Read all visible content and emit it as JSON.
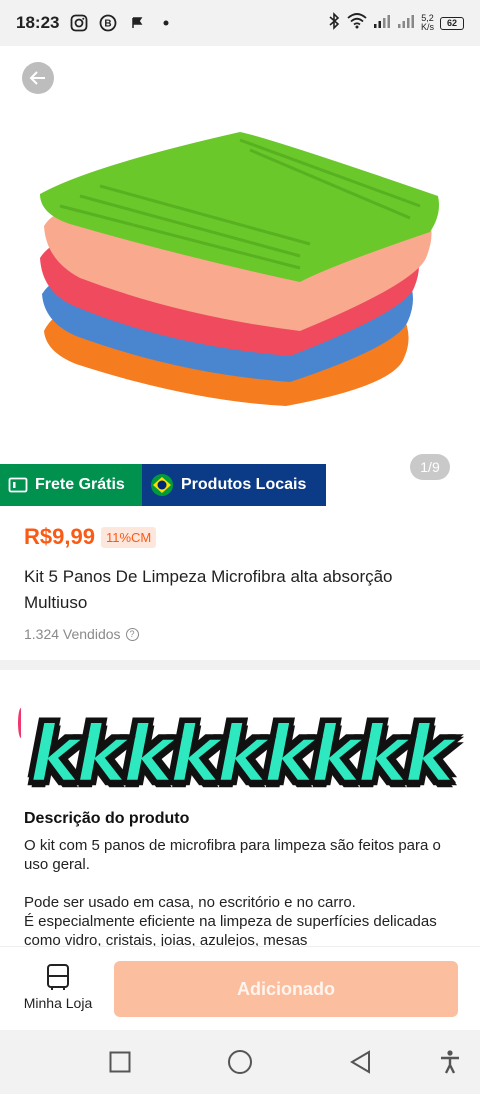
{
  "status_bar": {
    "time": "18:23",
    "net_speed_value": "5,2",
    "net_speed_unit": "K/s",
    "battery": "62"
  },
  "gallery": {
    "counter": "1/9"
  },
  "badges": {
    "free_shipping": "Frete Grátis",
    "local_products": "Produtos Locais"
  },
  "product": {
    "price": "R$9,99",
    "discount": "11%CM",
    "title": "Kit 5 Panos De Limpeza Microfibra alta absorção Multiuso",
    "sold": "1.324 Vendidos"
  },
  "overlay_sticker": "kkkkkkkkk",
  "description": {
    "heading": "Descrição do produto",
    "body": "O kit com 5 panos de microfibra para limpeza são feitos para o uso geral.\n\nPode ser usado em casa, no escritório e no carro.\nÉ especialmente eficiente na limpeza de superfícies delicadas como vidro, cristais, joias, azulejos, mesas"
  },
  "bottom_bar": {
    "store_label": "Minha Loja",
    "add_button": "Adicionado"
  },
  "colors": {
    "accent": "#fa5a14",
    "free_shipping_bg": "#00914f",
    "local_products_bg": "#0b3a86",
    "button_disabled": "#fbbfa0",
    "sticker": "#2ee8c0"
  },
  "icons": [
    "instagram-icon",
    "b-icon",
    "flag-icon",
    "bluetooth-icon",
    "wifi-icon",
    "signal-icon",
    "battery-icon",
    "back-arrow-icon",
    "truck-icon",
    "brazil-flag-icon",
    "help-icon",
    "store-icon",
    "square-nav-icon",
    "circle-nav-icon",
    "back-nav-icon",
    "accessibility-icon"
  ]
}
